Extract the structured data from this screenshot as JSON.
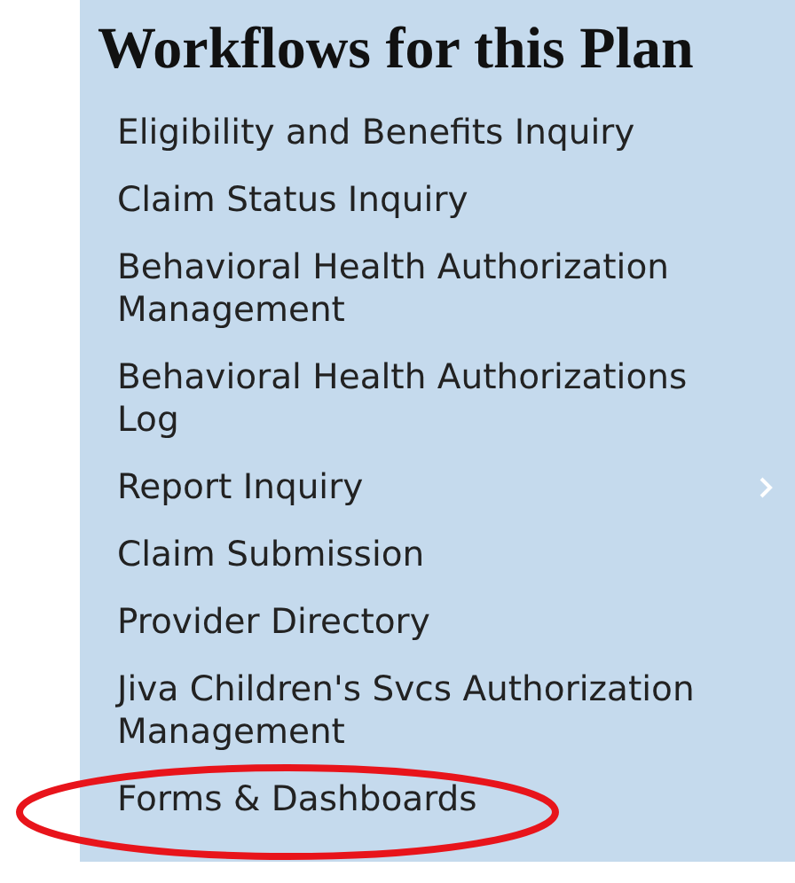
{
  "panel": {
    "title": "Workflows for this Plan",
    "items": [
      {
        "label": "Eligibility and Benefits Inquiry",
        "has_submenu": false,
        "circled": false
      },
      {
        "label": "Claim Status Inquiry",
        "has_submenu": false,
        "circled": false
      },
      {
        "label": "Behavioral Health Authorization Management",
        "has_submenu": false,
        "circled": false
      },
      {
        "label": "Behavioral Health Authorizations Log",
        "has_submenu": false,
        "circled": false
      },
      {
        "label": "Report Inquiry",
        "has_submenu": true,
        "circled": false
      },
      {
        "label": "Claim Submission",
        "has_submenu": false,
        "circled": false
      },
      {
        "label": "Provider Directory",
        "has_submenu": false,
        "circled": false
      },
      {
        "label": "Jiva Children's Svcs Authorization Management",
        "has_submenu": false,
        "circled": false
      },
      {
        "label": "Forms & Dashboards",
        "has_submenu": false,
        "circled": true
      }
    ]
  }
}
